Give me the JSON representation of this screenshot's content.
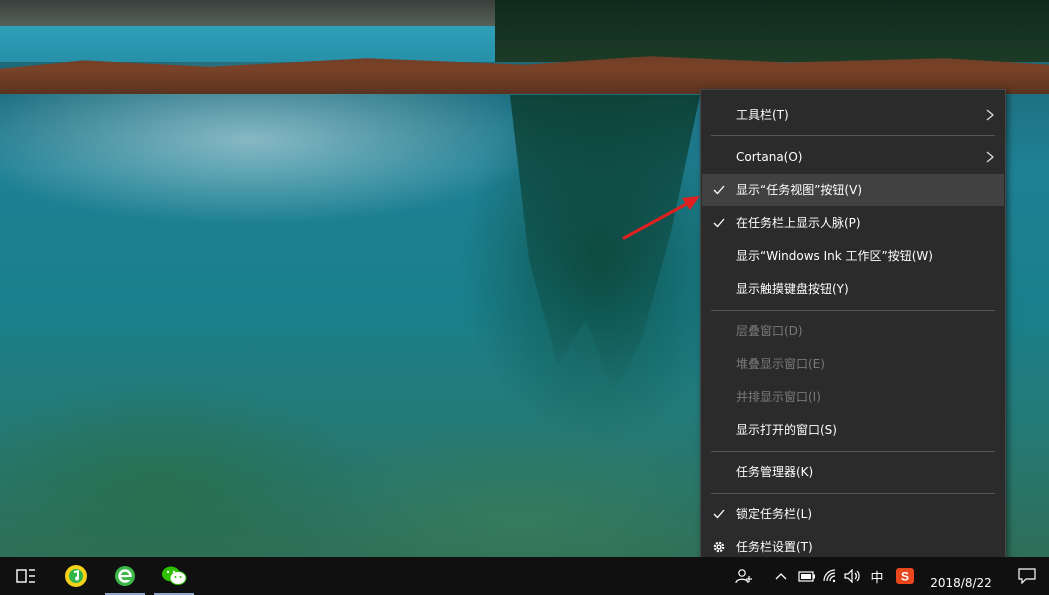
{
  "context_menu": {
    "items": [
      {
        "label": "工具栏(T)",
        "checked": false,
        "enabled": true,
        "submenu": true
      },
      {
        "label": "Cortana(O)",
        "checked": false,
        "enabled": true,
        "submenu": true
      },
      {
        "label": "显示“任务视图”按钮(V)",
        "checked": true,
        "enabled": true,
        "highlighted": true
      },
      {
        "label": "在任务栏上显示人脉(P)",
        "checked": true,
        "enabled": true
      },
      {
        "label": "显示“Windows Ink 工作区”按钮(W)",
        "checked": false,
        "enabled": true
      },
      {
        "label": "显示触摸键盘按钮(Y)",
        "checked": false,
        "enabled": true
      },
      {
        "label": "层叠窗口(D)",
        "checked": false,
        "enabled": false
      },
      {
        "label": "堆叠显示窗口(E)",
        "checked": false,
        "enabled": false
      },
      {
        "label": "并排显示窗口(I)",
        "checked": false,
        "enabled": false
      },
      {
        "label": "显示打开的窗口(S)",
        "checked": false,
        "enabled": true
      },
      {
        "label": "任务管理器(K)",
        "checked": false,
        "enabled": true
      },
      {
        "label": "锁定任务栏(L)",
        "checked": true,
        "enabled": true
      },
      {
        "label": "任务栏设置(T)",
        "checked": false,
        "enabled": true,
        "icon": "gear-icon"
      }
    ]
  },
  "taskbar": {
    "apps": [
      {
        "name": "task-view-icon"
      },
      {
        "name": "qq-music-icon"
      },
      {
        "name": "ie-browser-icon"
      },
      {
        "name": "wechat-icon"
      }
    ],
    "tray": {
      "ime": "中",
      "sogou_label": "S",
      "date": "2018/8/22"
    }
  },
  "colors": {
    "menu_bg": "#2b2b2b",
    "menu_hover": "#414141",
    "disabled_text": "#7a7a7a",
    "taskbar_bg": "#101010",
    "arrow_annotation": "#e02020"
  }
}
